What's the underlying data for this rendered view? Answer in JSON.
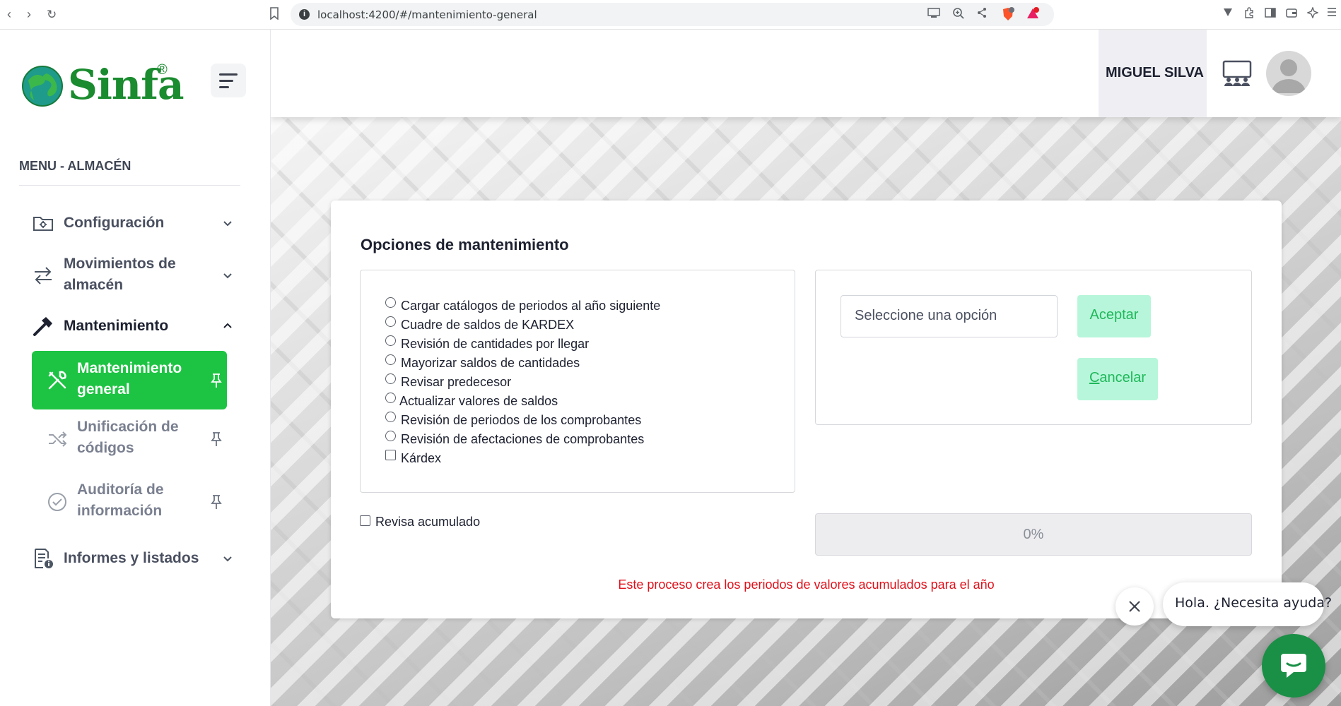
{
  "browser": {
    "url": "localhost:4200/#/mantenimiento-general"
  },
  "brand": {
    "name": "Sinfa",
    "registered": "®",
    "color": "#1a8b2f"
  },
  "sidebar": {
    "menu_title": "MENU - ALMACÉN",
    "items": [
      {
        "label": "Configuración",
        "icon": "folder-settings-icon"
      },
      {
        "label_line1": "Movimientos de",
        "label_line2": "almacén",
        "icon": "transfer-arrows-icon"
      },
      {
        "label": "Mantenimiento",
        "icon": "hammer-icon"
      },
      {
        "label": "Informes y listados",
        "icon": "report-info-icon"
      }
    ],
    "subitems": [
      {
        "label_line1": "Mantenimiento",
        "label_line2": "general",
        "icon": "tools-icon",
        "active": true
      },
      {
        "label_line1": "Unificación de",
        "label_line2": "códigos",
        "icon": "shuffle-icon",
        "active": false
      },
      {
        "label_line1": "Auditoría de",
        "label_line2": "información",
        "icon": "check-circle-icon",
        "active": false
      }
    ],
    "active_color": "#1dc443"
  },
  "header": {
    "user_name": "MIGUEL SILVA"
  },
  "card": {
    "title": "Opciones de mantenimiento",
    "options": [
      "Cargar catálogos de periodos al año siguiente",
      "Cuadre de saldos de KARDEX",
      "Revisión de cantidades por llegar",
      "Mayorizar saldos de cantidades",
      "Revisar predecesor",
      "Actualizar valores de saldos",
      "Revisión de periodos de los comprobantes",
      "Revisión de afectaciones de comprobantes"
    ],
    "kardex_label": "Kárdex",
    "select_placeholder": "Seleccione una opción",
    "accept_label": "Aceptar",
    "cancel_label": "ancelar",
    "cancel_accesskey": "C",
    "revisa_label": "Revisa acumulado",
    "progress_text": "0%",
    "progress_value": 0,
    "warning": "Este proceso crea los periodos de valores acumulados para el año",
    "warning_color": "#e0101a",
    "button_bg": "#b7f6da"
  },
  "chat": {
    "greeting": "Hola. ¿Necesita ayuda?",
    "button_color": "#1a8f46"
  }
}
